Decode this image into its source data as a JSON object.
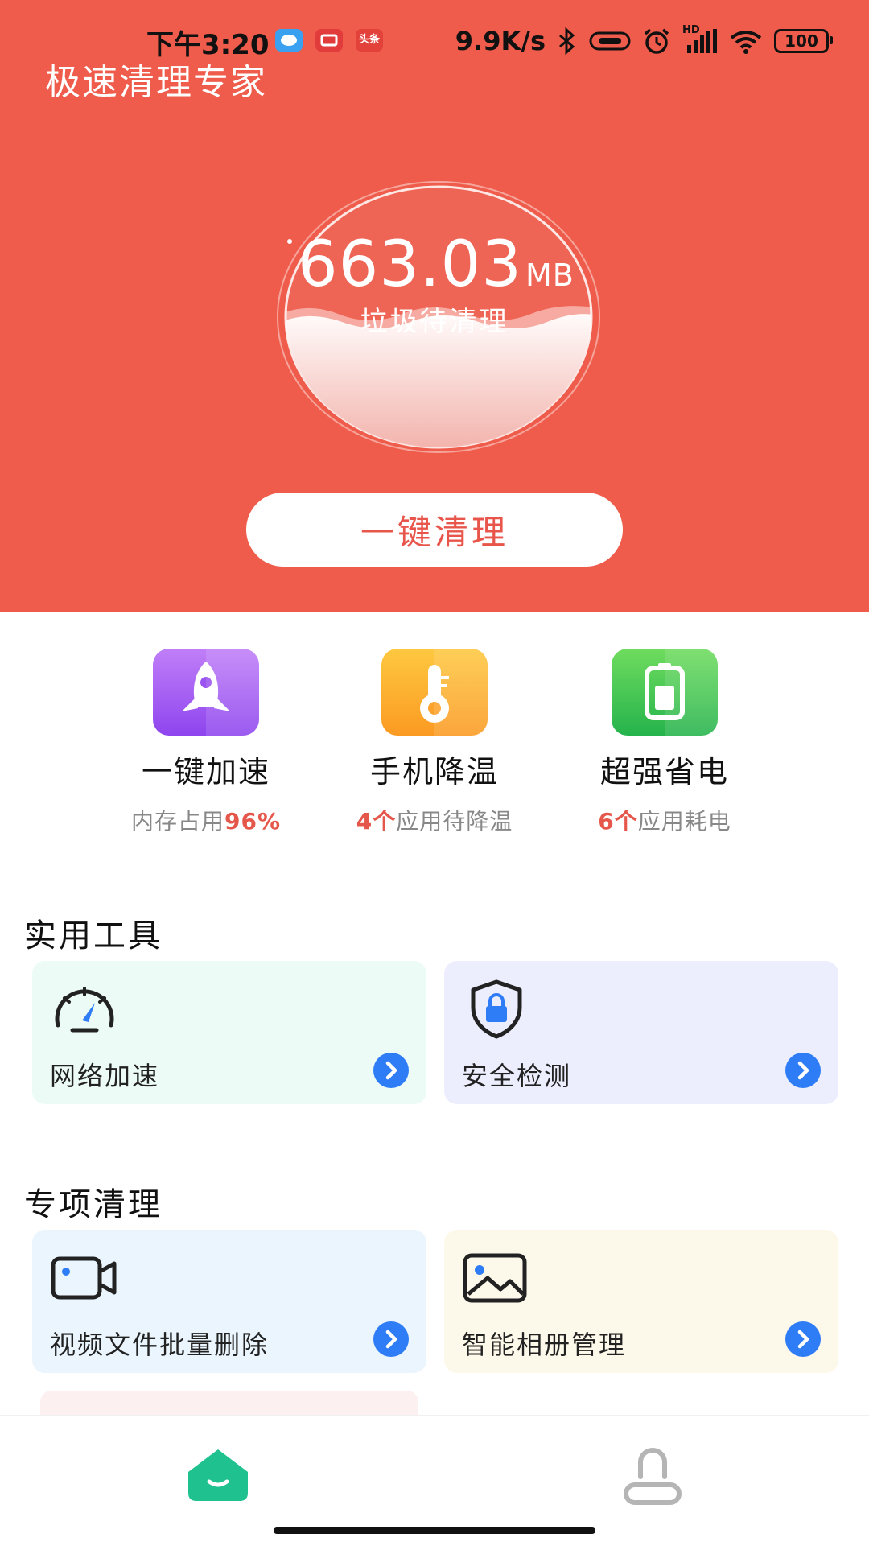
{
  "status_bar": {
    "time": "下午3:20",
    "net_speed": "9.9K/s",
    "network": "HD",
    "battery": "100",
    "icons": [
      "message-app-icon",
      "video-app-icon",
      "toutiao-app-icon",
      "bluetooth-icon",
      "nfc-icon",
      "alarm-icon",
      "signal-icon",
      "wifi-icon",
      "battery-icon"
    ],
    "toutiao_badge": "头条"
  },
  "header": {
    "title": "极速清理专家"
  },
  "gauge": {
    "size": "663.03",
    "unit": "MB",
    "label": "垃圾待清理"
  },
  "clean_button": {
    "label": "一键清理"
  },
  "quick_actions": [
    {
      "label": "一键加速",
      "sub_prefix": "内存占用",
      "sub_highlight": "96%",
      "sub_suffix": "",
      "icon": "rocket-icon",
      "color": "#a35bf2"
    },
    {
      "label": "手机降温",
      "sub_prefix": "",
      "sub_highlight": "4个",
      "sub_suffix": "应用待降温",
      "icon": "thermometer-icon",
      "color": "#fca22b"
    },
    {
      "label": "超强省电",
      "sub_prefix": "",
      "sub_highlight": "6个",
      "sub_suffix": "应用耗电",
      "icon": "battery-saver-icon",
      "color": "#39c95a"
    }
  ],
  "tools": {
    "title": "实用工具",
    "cards": [
      {
        "label": "网络加速",
        "icon": "speedometer-icon",
        "bg": "#ecfbf6"
      },
      {
        "label": "安全检测",
        "icon": "shield-lock-icon",
        "bg": "#eceefd"
      }
    ]
  },
  "special_clean": {
    "title": "专项清理",
    "cards": [
      {
        "label": "视频文件批量删除",
        "icon": "video-camera-icon",
        "bg": "#eaf5fd"
      },
      {
        "label": "智能相册管理",
        "icon": "image-icon",
        "bg": "#fdf9ea"
      }
    ]
  },
  "tab_bar": {
    "tabs": [
      {
        "name": "home",
        "icon": "home-icon",
        "active": true
      },
      {
        "name": "profile",
        "icon": "user-icon",
        "active": false
      }
    ]
  },
  "colors": {
    "hero": "#ef5c4b",
    "accent_text": "#e5574b",
    "arrow_blue": "#2f7df6",
    "tab_active": "#1fc28f",
    "tab_inactive": "#b5b5b5"
  }
}
